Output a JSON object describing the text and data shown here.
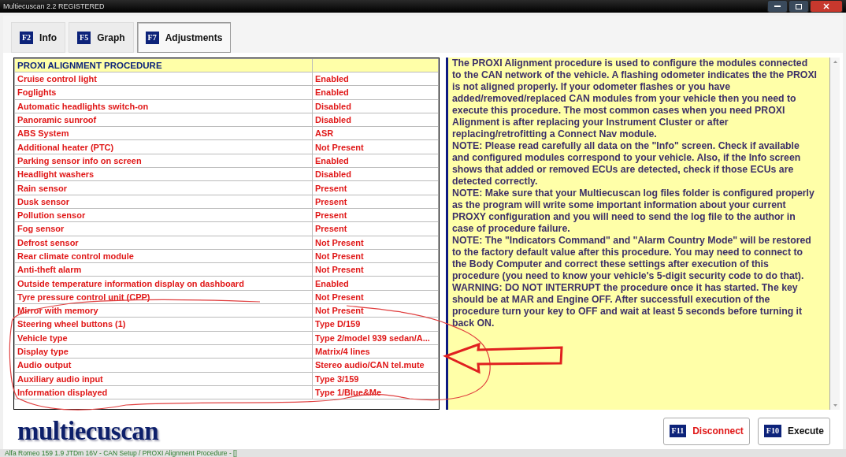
{
  "window": {
    "title": "Multiecuscan 2.2 REGISTERED"
  },
  "tabs": [
    {
      "key": "F2",
      "label": "Info",
      "selected": false
    },
    {
      "key": "F5",
      "label": "Graph",
      "selected": false
    },
    {
      "key": "F7",
      "label": "Adjustments",
      "selected": true
    }
  ],
  "table": {
    "title": "PROXI ALIGNMENT PROCEDURE",
    "rows": [
      {
        "name": "Cruise control light",
        "value": "Enabled"
      },
      {
        "name": "Foglights",
        "value": "Enabled"
      },
      {
        "name": "Automatic headlights switch-on",
        "value": "Disabled"
      },
      {
        "name": "Panoramic sunroof",
        "value": "Disabled"
      },
      {
        "name": "ABS System",
        "value": "ASR"
      },
      {
        "name": "Additional heater (PTC)",
        "value": "Not Present"
      },
      {
        "name": "Parking sensor info on screen",
        "value": "Enabled"
      },
      {
        "name": "Headlight washers",
        "value": "Disabled"
      },
      {
        "name": "Rain sensor",
        "value": "Present"
      },
      {
        "name": "Dusk sensor",
        "value": "Present"
      },
      {
        "name": "Pollution sensor",
        "value": "Present"
      },
      {
        "name": "Fog sensor",
        "value": "Present"
      },
      {
        "name": "Defrost sensor",
        "value": "Not Present"
      },
      {
        "name": "Rear climate control module",
        "value": "Not Present"
      },
      {
        "name": "Anti-theft alarm",
        "value": "Not Present"
      },
      {
        "name": "Outside temperature information display on dashboard",
        "value": "Enabled"
      },
      {
        "name": "Tyre pressure control unit (CPP)",
        "value": "Not Present"
      },
      {
        "name": "Mirror with memory",
        "value": "Not Present"
      },
      {
        "name": "Steering wheel buttons (1)",
        "value": "Type D/159"
      },
      {
        "name": "Vehicle type",
        "value": "Type 2/model 939 sedan/A..."
      },
      {
        "name": "Display type",
        "value": "Matrix/4 lines"
      },
      {
        "name": "Audio output",
        "value": "Stereo audio/CAN tel.mute"
      },
      {
        "name": "Auxiliary audio input",
        "value": "Type 3/159"
      },
      {
        "name": "Information displayed",
        "value": "Type 1/Blue&Me"
      }
    ]
  },
  "help": {
    "paragraphs": [
      "The PROXI Alignment procedure is used to configure the modules connected to the CAN network of the vehicle. A flashing odometer indicates the the PROXI is not aligned properly. If your odometer flashes or you have added/removed/replaced CAN modules from your vehicle then you need to execute this procedure. The most common cases when you need PROXI Alignment is after replacing your Instrument Cluster or after replacing/retrofitting a Connect Nav module.",
      "NOTE: Please read carefully all data on the \"Info\" screen. Check if available and configured modules correspond to your vehicle. Also, if the Info screen shows that added or removed ECUs are detected, check if those ECUs are detected correctly.",
      "NOTE: Make sure that your Multiecuscan log files folder is configured properly as the program will write some important information about your current PROXY configuration and you will need to send the log file to the author in case of procedure failure.",
      "NOTE: The \"Indicators Command\" and \"Alarm Country Mode\" will be restored to the factory default value after this procedure. You may need to connect to the Body Computer and correct these settings after execution of this procedure (you need to know your vehicle's 5-digit security code to do that).",
      "WARNING: DO NOT INTERRUPT the procedure once it has started. The key should be at MAR and Engine OFF. After successfull execution of the procedure turn your key to OFF and wait at least 5 seconds before turning it back ON."
    ]
  },
  "logo": "multiecuscan",
  "buttons": [
    {
      "key": "F11",
      "label": "Disconnect",
      "kind": "danger"
    },
    {
      "key": "F10",
      "label": "Execute",
      "kind": "normal"
    }
  ],
  "status_bar": "Alfa Romeo 159 1.9 JTDm 16V - CAN Setup / PROXI Alignment Procedure - []",
  "annotations": [
    {
      "kind": "loop"
    },
    {
      "kind": "arrow"
    }
  ]
}
